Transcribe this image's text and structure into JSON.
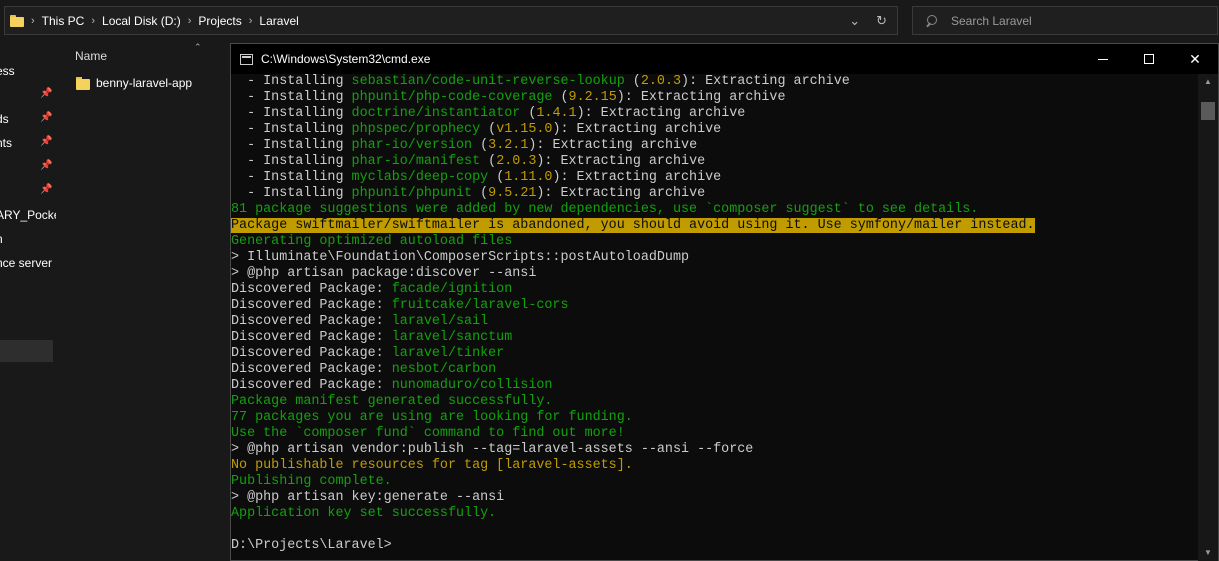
{
  "address_bar": {
    "breadcrumbs": [
      "This PC",
      "Local Disk (D:)",
      "Projects",
      "Laravel"
    ],
    "dropdown_icon": "chevron-down-icon",
    "refresh_icon": "refresh-icon"
  },
  "search": {
    "placeholder": "Search Laravel"
  },
  "nav_pane": {
    "items": [
      {
        "label": "ess",
        "pinned": false
      },
      {
        "label": "ds",
        "pinned": true
      },
      {
        "label": "nts",
        "pinned": true
      },
      {
        "label": "",
        "pinned": true
      },
      {
        "label": "",
        "pinned": true
      },
      {
        "label": "ARY_Pocke",
        "pinned": false
      },
      {
        "label": "n",
        "pinned": false
      },
      {
        "label": "nce server",
        "pinned": false
      }
    ]
  },
  "file_pane": {
    "column_header": "Name",
    "items": [
      {
        "name": "benny-laravel-app",
        "type": "folder"
      }
    ]
  },
  "cmd_window": {
    "title": "C:\\Windows\\System32\\cmd.exe",
    "buttons": {
      "minimize": "minimize-icon",
      "maximize": "maximize-icon",
      "close": "close-icon"
    },
    "lines": [
      [
        {
          "t": "  - Installing "
        },
        {
          "t": "sebastian/code-unit-reverse-lookup",
          "c": "g"
        },
        {
          "t": " ("
        },
        {
          "t": "2.0.3",
          "c": "y"
        },
        {
          "t": "): Extracting archive"
        }
      ],
      [
        {
          "t": "  - Installing "
        },
        {
          "t": "phpunit/php-code-coverage",
          "c": "g"
        },
        {
          "t": " ("
        },
        {
          "t": "9.2.15",
          "c": "y"
        },
        {
          "t": "): Extracting archive"
        }
      ],
      [
        {
          "t": "  - Installing "
        },
        {
          "t": "doctrine/instantiator",
          "c": "g"
        },
        {
          "t": " ("
        },
        {
          "t": "1.4.1",
          "c": "y"
        },
        {
          "t": "): Extracting archive"
        }
      ],
      [
        {
          "t": "  - Installing "
        },
        {
          "t": "phpspec/prophecy",
          "c": "g"
        },
        {
          "t": " ("
        },
        {
          "t": "v1.15.0",
          "c": "y"
        },
        {
          "t": "): Extracting archive"
        }
      ],
      [
        {
          "t": "  - Installing "
        },
        {
          "t": "phar-io/version",
          "c": "g"
        },
        {
          "t": " ("
        },
        {
          "t": "3.2.1",
          "c": "y"
        },
        {
          "t": "): Extracting archive"
        }
      ],
      [
        {
          "t": "  - Installing "
        },
        {
          "t": "phar-io/manifest",
          "c": "g"
        },
        {
          "t": " ("
        },
        {
          "t": "2.0.3",
          "c": "y"
        },
        {
          "t": "): Extracting archive"
        }
      ],
      [
        {
          "t": "  - Installing "
        },
        {
          "t": "myclabs/deep-copy",
          "c": "g"
        },
        {
          "t": " ("
        },
        {
          "t": "1.11.0",
          "c": "y"
        },
        {
          "t": "): Extracting archive"
        }
      ],
      [
        {
          "t": "  - Installing "
        },
        {
          "t": "phpunit/phpunit",
          "c": "g"
        },
        {
          "t": " ("
        },
        {
          "t": "9.5.21",
          "c": "y"
        },
        {
          "t": "): Extracting archive"
        }
      ],
      [
        {
          "t": "81 package suggestions were added by new dependencies, use `composer suggest` to see details.",
          "c": "g"
        }
      ],
      [
        {
          "t": "Package swiftmailer/swiftmailer is abandoned, you should avoid using it. Use symfony/mailer instead.",
          "c": "hl"
        }
      ],
      [
        {
          "t": "Generating optimized autoload files",
          "c": "g"
        }
      ],
      [
        {
          "t": "> Illuminate\\Foundation\\ComposerScripts::postAutoloadDump"
        }
      ],
      [
        {
          "t": "> @php artisan package:discover --ansi"
        }
      ],
      [
        {
          "t": "Discovered Package: "
        },
        {
          "t": "facade/ignition",
          "c": "g"
        }
      ],
      [
        {
          "t": "Discovered Package: "
        },
        {
          "t": "fruitcake/laravel-cors",
          "c": "g"
        }
      ],
      [
        {
          "t": "Discovered Package: "
        },
        {
          "t": "laravel/sail",
          "c": "g"
        }
      ],
      [
        {
          "t": "Discovered Package: "
        },
        {
          "t": "laravel/sanctum",
          "c": "g"
        }
      ],
      [
        {
          "t": "Discovered Package: "
        },
        {
          "t": "laravel/tinker",
          "c": "g"
        }
      ],
      [
        {
          "t": "Discovered Package: "
        },
        {
          "t": "nesbot/carbon",
          "c": "g"
        }
      ],
      [
        {
          "t": "Discovered Package: "
        },
        {
          "t": "nunomaduro/collision",
          "c": "g"
        }
      ],
      [
        {
          "t": "Package manifest generated successfully.",
          "c": "g"
        }
      ],
      [
        {
          "t": "77 packages you are using are looking for funding.",
          "c": "g"
        }
      ],
      [
        {
          "t": "Use the `composer fund` command to find out more!",
          "c": "g"
        }
      ],
      [
        {
          "t": "> @php artisan vendor:publish --tag=laravel-assets --ansi --force"
        }
      ],
      [
        {
          "t": "No publishable resources for tag [laravel-assets].",
          "c": "y"
        }
      ],
      [
        {
          "t": "Publishing complete.",
          "c": "g"
        }
      ],
      [
        {
          "t": "> @php artisan key:generate --ansi"
        }
      ],
      [
        {
          "t": "Application key set successfully.",
          "c": "g"
        }
      ],
      [
        {
          "t": ""
        }
      ],
      [
        {
          "t": "D:\\Projects\\Laravel>"
        }
      ]
    ]
  },
  "colors": {
    "console_bg": "#0c0c0c",
    "console_text": "#cccccc",
    "green": "#13a10e",
    "yellow": "#c19c00"
  }
}
